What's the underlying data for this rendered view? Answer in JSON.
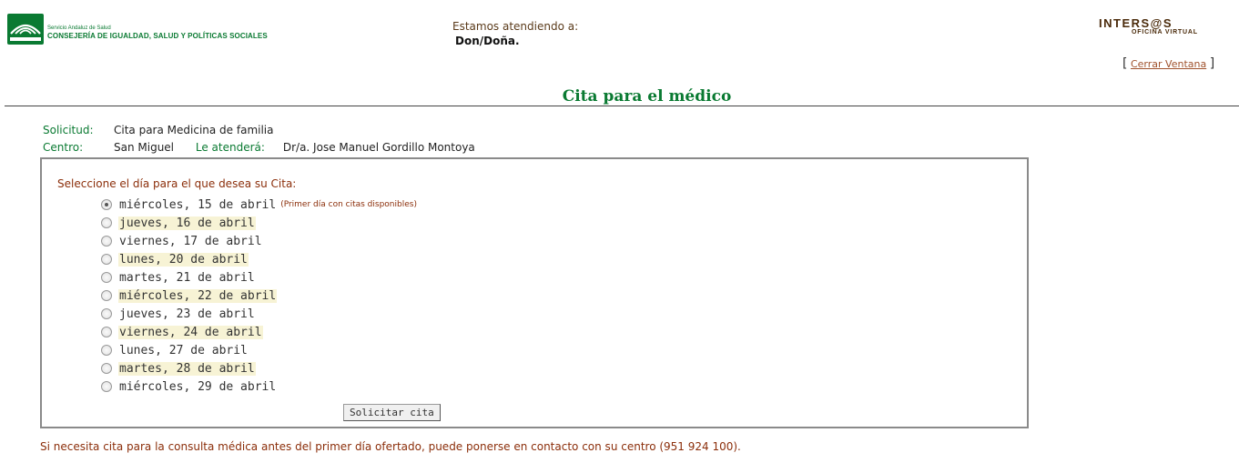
{
  "header": {
    "logo_small": "Servicio Andaluz de Salud",
    "logo_main": "CONSEJERÍA DE IGUALDAD, SALUD Y POLÍTICAS SOCIALES",
    "attending_label": "Estamos atendiendo a:",
    "attending_name": "Don/Doña.",
    "brand": "INTERS@S",
    "brand_sub": "OFICINA VIRTUAL",
    "close_window": "Cerrar Ventana"
  },
  "page_title": "Cita para el médico",
  "info": {
    "solicitud_label": "Solicitud:",
    "solicitud_value": "Cita para Medicina de familia",
    "centro_label": "Centro:",
    "centro_value": "San Miguel",
    "atendera_label": "Le atenderá:",
    "atendera_value": "Dr/a. Jose Manuel Gordillo Montoya"
  },
  "form": {
    "prompt": "Seleccione el día para el que desea su Cita:",
    "first_day_note": "(Primer día con citas disponibles)",
    "dates": [
      {
        "label": "miércoles, 15 de abril",
        "checked": true,
        "highlight": false
      },
      {
        "label": "jueves, 16 de abril",
        "checked": false,
        "highlight": true
      },
      {
        "label": "viernes, 17 de abril",
        "checked": false,
        "highlight": false
      },
      {
        "label": "lunes, 20 de abril",
        "checked": false,
        "highlight": true
      },
      {
        "label": "martes, 21 de abril",
        "checked": false,
        "highlight": false
      },
      {
        "label": "miércoles, 22 de abril",
        "checked": false,
        "highlight": true
      },
      {
        "label": "jueves, 23 de abril",
        "checked": false,
        "highlight": false
      },
      {
        "label": "viernes, 24 de abril",
        "checked": false,
        "highlight": true
      },
      {
        "label": "lunes, 27 de abril",
        "checked": false,
        "highlight": false
      },
      {
        "label": "martes, 28 de abril",
        "checked": false,
        "highlight": true
      },
      {
        "label": "miércoles, 29 de abril",
        "checked": false,
        "highlight": false
      }
    ],
    "submit_label": "Solicitar cita"
  },
  "footer_note": "Si necesita cita para la consulta médica antes del primer día ofertado, puede ponerse en contacto con su centro (951 924 100).",
  "colors": {
    "green": "#0a7a32",
    "brown": "#8b2e0a",
    "highlight": "#f7f3d5"
  }
}
